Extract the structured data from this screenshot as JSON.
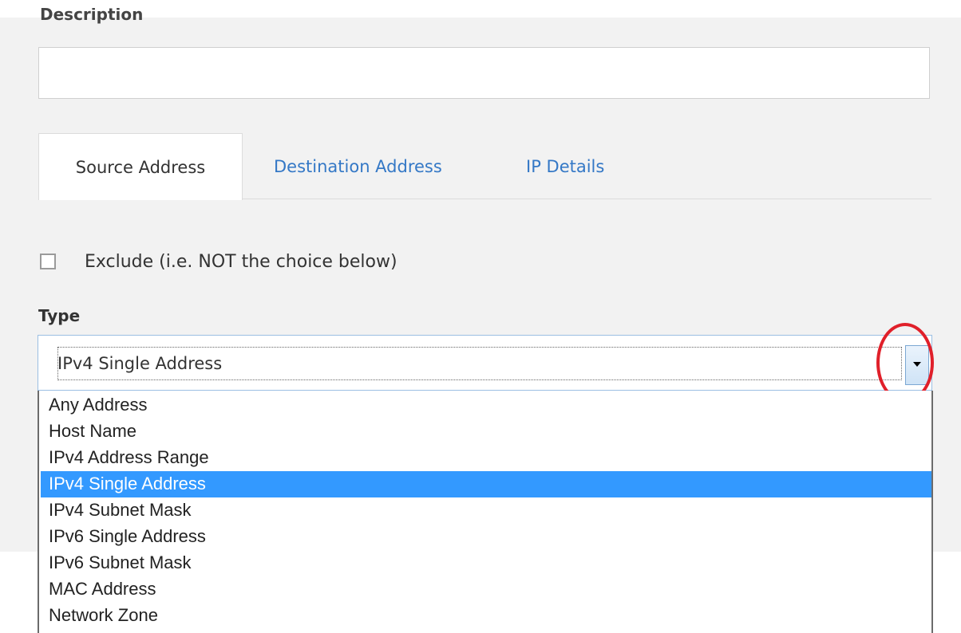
{
  "description": {
    "label": "Description",
    "value": ""
  },
  "tabs": [
    {
      "label": "Source Address",
      "active": true
    },
    {
      "label": "Destination Address",
      "active": false
    },
    {
      "label": "IP Details",
      "active": false
    }
  ],
  "exclude": {
    "label": "Exclude (i.e. NOT the choice below)",
    "checked": false
  },
  "type": {
    "label": "Type",
    "selected": "IPv4 Single Address",
    "options": [
      "Any Address",
      "Host Name",
      "IPv4 Address Range",
      "IPv4 Single Address",
      "IPv4 Subnet Mask",
      "IPv6 Single Address",
      "IPv6 Subnet Mask",
      "MAC Address",
      "Network Zone"
    ]
  },
  "colors": {
    "link": "#3478c6",
    "selected_highlight": "#3399ff",
    "annotation_circle": "#e0202a"
  }
}
